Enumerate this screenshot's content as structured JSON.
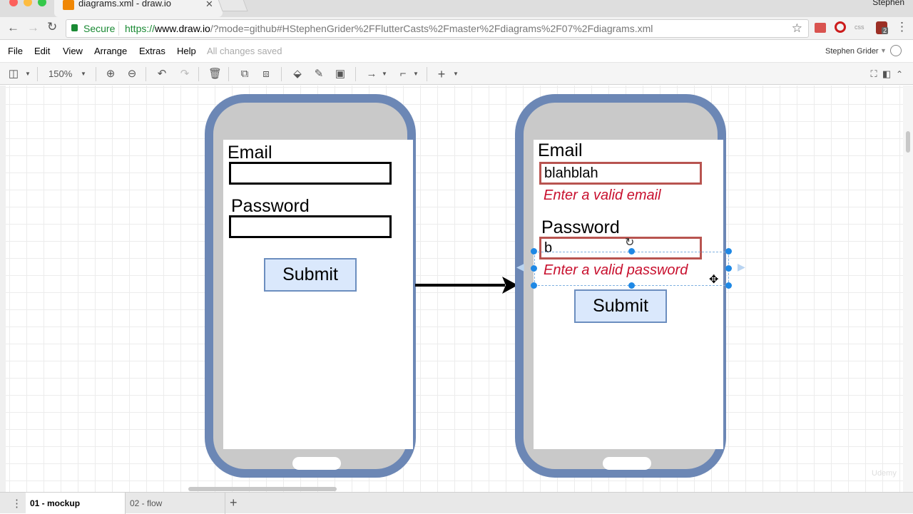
{
  "browser": {
    "tab_title": "diagrams.xml - draw.io",
    "profile_name": "Stephen",
    "secure_label": "Secure",
    "url_prefix": "https://",
    "url_host": "www.draw.io",
    "url_path": "/?mode=github#HStephenGrider%2FFlutterCasts%2Fmaster%2Fdiagrams%2F07%2Fdiagrams.xml",
    "ext_css_label": "css",
    "ext_badge": "2"
  },
  "menu": {
    "items": [
      "File",
      "Edit",
      "View",
      "Arrange",
      "Extras",
      "Help"
    ],
    "status": "All changes saved",
    "user": "Stephen Grider"
  },
  "toolbar": {
    "zoom": "150%"
  },
  "diagram": {
    "phone1": {
      "email_label": "Email",
      "email_value": "",
      "password_label": "Password",
      "password_value": "",
      "submit_label": "Submit"
    },
    "phone2": {
      "email_label": "Email",
      "email_value": "blahblah",
      "email_error": "Enter a valid email",
      "password_label": "Password",
      "password_value": "b",
      "password_error": "Enter a valid password",
      "submit_label": "Submit"
    }
  },
  "pages": [
    "01 - mockup",
    "02 - flow"
  ],
  "colors": {
    "phone_frame": "#6c87b5",
    "phone_body": "#c9c9c9",
    "error_text": "#c8102e",
    "error_border": "#b85450",
    "button_fill": "#dae8fc",
    "button_border": "#6c8ebf",
    "selection": "#1e88e5",
    "secure_green": "#1a8a34"
  },
  "watermark": "Udemy"
}
